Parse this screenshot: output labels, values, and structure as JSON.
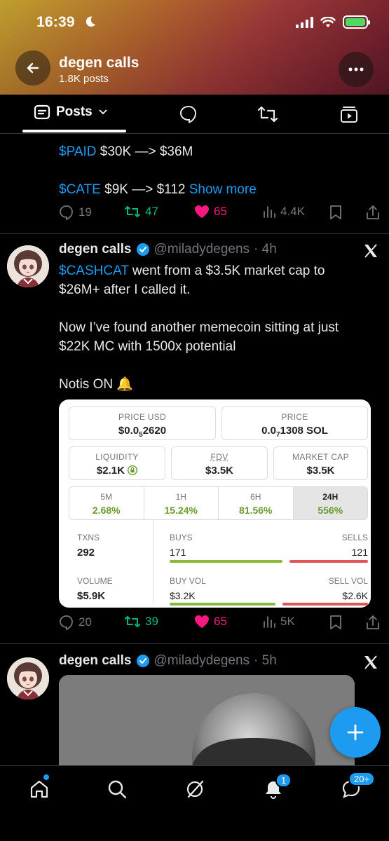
{
  "status_bar": {
    "time": "16:39"
  },
  "header": {
    "title": "degen calls",
    "subtitle": "1.8K posts"
  },
  "tabs": {
    "posts_label": "Posts"
  },
  "tweet1": {
    "line1_ticker": "$PAID",
    "line1_rest": " $30K —> $36M",
    "line2_ticker": "$CATE",
    "line2_rest": " $9K —> $112 ",
    "show_more": "Show more",
    "replies": "19",
    "reposts": "47",
    "likes": "65",
    "views": "4.4K"
  },
  "tweet2": {
    "name": "degen calls",
    "handle": "@miladydegens",
    "time": "· 4h",
    "ticker": "$CASHCAT",
    "text1": " went from a $3.5K market cap to $26M+ after I called it.",
    "text2": "Now I’ve found another memecoin sitting at just $22K MC with 1500x  potential",
    "text3": "Notis ON 🔔",
    "replies": "20",
    "reposts": "39",
    "likes": "65",
    "views": "5K"
  },
  "dex": {
    "price_usd_label": "PRICE USD",
    "price_usd_a": "$0.0",
    "price_usd_sub": "5",
    "price_usd_b": "2620",
    "price_label": "PRICE",
    "price_a": "0.0",
    "price_sub": "7",
    "price_b": "1308 SOL",
    "liquidity_label": "LIQUIDITY",
    "liquidity": "$2.1K",
    "fdv_label": "FDV",
    "fdv": "$3.5K",
    "mcap_label": "MARKET CAP",
    "mcap": "$3.5K",
    "timeframes": [
      {
        "label": "5M",
        "value": "2.68%"
      },
      {
        "label": "1H",
        "value": "15.24%"
      },
      {
        "label": "6H",
        "value": "81.56%"
      },
      {
        "label": "24H",
        "value": "556%"
      }
    ],
    "txns_label": "TXNS",
    "txns": "292",
    "buys_label": "BUYS",
    "buys": "171",
    "sells_label": "SELLS",
    "sells": "121",
    "buys_share": 0.585,
    "volume_label": "VOLUME",
    "volume": "$5.9K",
    "buy_vol_label": "BUY VOL",
    "buy_vol": "$3.2K",
    "sell_vol_label": "SELL VOL",
    "sell_vol": "$2.6K",
    "buy_vol_share": 0.55,
    "colors": {
      "green": "#8ab83a",
      "red": "#e05555"
    }
  },
  "tweet3": {
    "name": "degen calls",
    "handle": "@miladydegens",
    "time": "· 5h"
  },
  "nav": {
    "notif_badge": "1",
    "messages_badge": "20+"
  },
  "colors": {
    "accent": "#1d9bf0",
    "repost": "#00ba7c",
    "like": "#f91880"
  }
}
